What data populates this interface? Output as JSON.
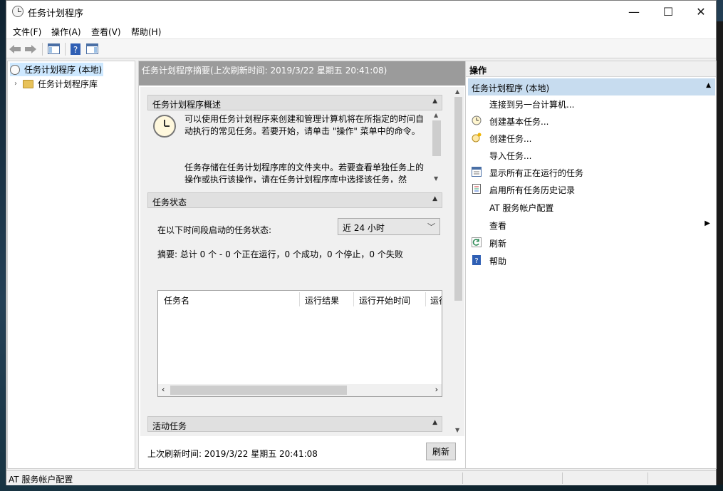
{
  "window": {
    "title": "任务计划程序",
    "minimize": "—",
    "maximize": "☐",
    "close": "✕"
  },
  "menu": [
    "文件(F)",
    "操作(A)",
    "查看(V)",
    "帮助(H)"
  ],
  "tree": {
    "root": "任务计划程序 (本地)",
    "child": "任务计划程序库"
  },
  "center": {
    "header": "任务计划程序摘要(上次刷新时间: 2019/3/22 星期五 20:41:08)",
    "overview_title": "任务计划程序概述",
    "overview_p1": "可以使用任务计划程序来创建和管理计算机将在所指定的时间自动执行的常见任务。若要开始，请单击 \"操作\" 菜单中的命令。",
    "overview_p2": "任务存储在任务计划程序库的文件夹中。若要查看单独任务上的操作或执行该操作，请在任务计划程序库中选择该任务，然",
    "status_title": "任务状态",
    "status_label": "在以下时间段启动的任务状态:",
    "status_combo": "近 24 小时",
    "summary": "摘要: 总计 0 个 - 0 个正在运行，0 个成功，0 个停止，0 个失败",
    "columns": [
      "任务名",
      "运行结果",
      "运行开始时间",
      "运行"
    ],
    "active_title": "活动任务",
    "last_refresh": "上次刷新时间: 2019/3/22 星期五 20:41:08",
    "refresh_button": "刷新"
  },
  "actions": {
    "header": "操作",
    "selected": "任务计划程序 (本地)",
    "items": [
      {
        "label": "连接到另一台计算机...",
        "icon": ""
      },
      {
        "label": "创建基本任务...",
        "icon": "basic-task-icon"
      },
      {
        "label": "创建任务...",
        "icon": "create-task-icon"
      },
      {
        "label": "导入任务...",
        "icon": ""
      },
      {
        "label": "显示所有正在运行的任务",
        "icon": "running-tasks-icon"
      },
      {
        "label": "启用所有任务历史记录",
        "icon": "history-icon"
      },
      {
        "label": "AT 服务帐户配置",
        "icon": ""
      },
      {
        "label": "查看",
        "icon": ""
      },
      {
        "label": "刷新",
        "icon": "refresh-icon"
      },
      {
        "label": "帮助",
        "icon": "help-icon"
      }
    ]
  },
  "statusbar": {
    "text": "AT 服务帐户配置"
  }
}
